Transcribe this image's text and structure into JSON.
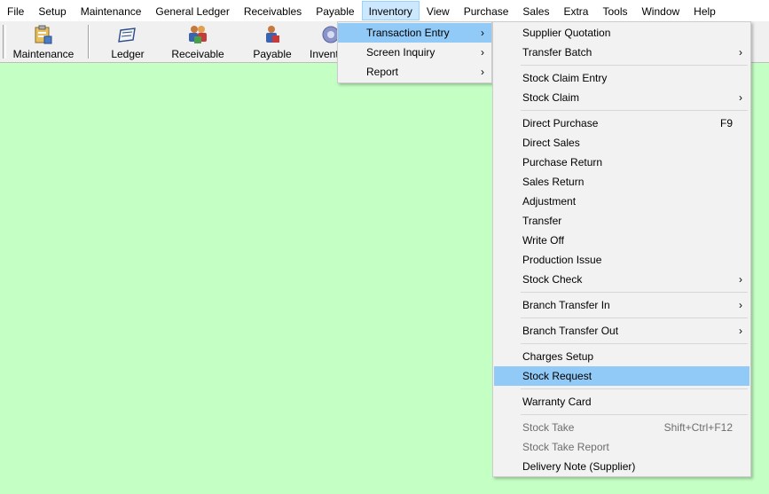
{
  "menubar": {
    "items": [
      "File",
      "Setup",
      "Maintenance",
      "General Ledger",
      "Receivables",
      "Payable",
      "Inventory",
      "View",
      "Purchase",
      "Sales",
      "Extra",
      "Tools",
      "Window",
      "Help"
    ]
  },
  "toolbar": {
    "buttons": [
      {
        "label": "Maintenance",
        "icon": "maintenance-icon"
      },
      {
        "label": "Ledger",
        "icon": "ledger-icon"
      },
      {
        "label": "Receivable",
        "icon": "receivable-icon"
      },
      {
        "label": "Payable",
        "icon": "payable-icon"
      },
      {
        "label": "Inventor",
        "icon": "inventory-gear-icon"
      }
    ]
  },
  "inventory_menu": {
    "items": [
      "Transaction Entry",
      "Screen Inquiry",
      "Report"
    ]
  },
  "transaction_submenu": {
    "supplier_quotation": "Supplier Quotation",
    "transfer_batch": "Transfer Batch",
    "stock_claim_entry": "Stock Claim Entry",
    "stock_claim": "Stock Claim",
    "direct_purchase": "Direct Purchase",
    "direct_purchase_shortcut": "F9",
    "direct_sales": "Direct Sales",
    "purchase_return": "Purchase Return",
    "sales_return": "Sales Return",
    "adjustment": "Adjustment",
    "transfer": "Transfer",
    "write_off": "Write Off",
    "production_issue": "Production Issue",
    "stock_check": "Stock Check",
    "branch_transfer_in": "Branch Transfer In",
    "branch_transfer_out": "Branch Transfer Out",
    "charges_setup": "Charges Setup",
    "stock_request": "Stock Request",
    "warranty_card": "Warranty Card",
    "stock_take": "Stock Take",
    "stock_take_shortcut": "Shift+Ctrl+F12",
    "stock_take_report": "Stock Take Report",
    "delivery_note": "Delivery Note (Supplier)"
  },
  "colors": {
    "workspace": "#c4ffc4",
    "highlight": "#91c9f7",
    "menubar_active": "#cce8ff"
  }
}
